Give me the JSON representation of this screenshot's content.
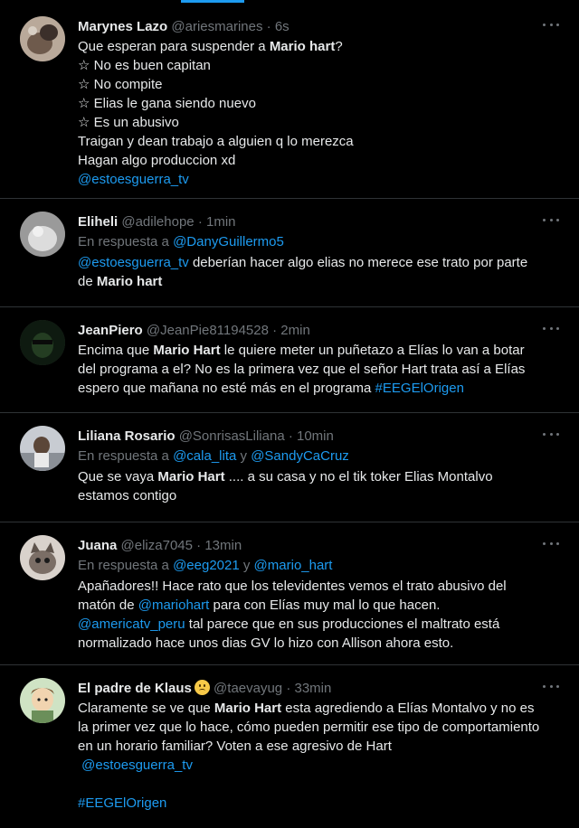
{
  "tweets": [
    {
      "name": "Marynes Lazo",
      "handle": "@ariesmarines",
      "sep": "·",
      "time": "6s",
      "lines": [
        [
          "Que esperan para suspender a ",
          "Mario hart",
          "?"
        ],
        [
          "☆ No es buen capitan"
        ],
        [
          "☆ No compite"
        ],
        [
          "☆ Elias le gana siendo nuevo"
        ],
        [
          "☆ Es un abusivo"
        ],
        [
          "Traigan  y dean trabajo a alguien q lo merezca"
        ],
        [
          "Hagan algo produccion xd"
        ]
      ],
      "mention": "@estoesguerra_tv"
    },
    {
      "name": "Eliheli",
      "handle": "@adilehope",
      "sep": "·",
      "time": "1min",
      "reply_prefix": "En respuesta a ",
      "reply_to": "@DanyGuillermo5",
      "text_mention": "@estoesguerra_tv",
      "text_a": " deberían hacer algo elias no merece ese trato por parte de ",
      "text_bold": "Mario hart"
    },
    {
      "name": "JeanPiero",
      "handle": "@JeanPie81194528",
      "sep": "·",
      "time": "2min",
      "text_a": "Encima que ",
      "text_bold": "Mario Hart",
      "text_b": " le quiere meter un puñetazo a Elías lo van a botar del programa a el? No es la primera vez que el señor Hart trata así a Elías espero que mañana no esté más en el programa ",
      "hashtag": "#EEGElOrigen"
    },
    {
      "name": "Liliana Rosario",
      "handle": "@SonrisasLiliana",
      "sep": "·",
      "time": "10min",
      "reply_prefix": "En respuesta a ",
      "reply_to": "@cala_lita",
      "reply_and": " y ",
      "reply_to2": "@SandyCaCruz",
      "text_a": "Que se vaya ",
      "text_bold": "Mario Hart",
      "text_b": " .... a su casa y no el tik toker Elias Montalvo estamos contigo"
    },
    {
      "name": "Juana",
      "handle": "@eliza7045",
      "sep": "·",
      "time": "13min",
      "reply_prefix": "En respuesta a ",
      "reply_to": "@eeg2021",
      "reply_and": " y ",
      "reply_to2": "@mario_hart",
      "text_a": "Apañadores!! Hace rato que los televidentes vemos el trato abusivo del matón de ",
      "mention1": "@mariohart",
      "text_b": " para con Elías muy mal lo que hacen.",
      "mention2": "@americatv_peru",
      "text_c": " tal parece que en sus producciones el maltrato está normalizado hace unos dias GV lo hizo con Allison ahora esto."
    },
    {
      "name": "El padre de Klaus",
      "handle": "@taevayug",
      "sep": "·",
      "time": "33min",
      "emoji": "sad-face",
      "text_a": "Claramente se ve que ",
      "text_bold": "Mario Hart",
      "text_b": " esta agrediendo a Elías Montalvo y no es la primer vez que lo hace, cómo pueden permitir ese tipo de comportamiento en un horario familiar? Voten a ese agresivo de Hart",
      "mention": "@estoesguerra_tv",
      "hashtag": "#EEGElOrigen"
    }
  ],
  "colors": {
    "accent": "#1d9bf0",
    "muted": "#71767b",
    "text": "#e7e9ea",
    "border": "#2f3336"
  }
}
